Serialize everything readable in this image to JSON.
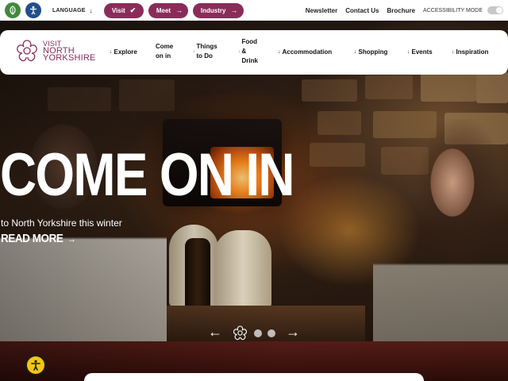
{
  "topbar": {
    "language_label": "LANGUAGE",
    "pills": [
      {
        "label": "Visit",
        "icon": "check-icon"
      },
      {
        "label": "Meet",
        "icon": "arrow-right-icon"
      },
      {
        "label": "Industry",
        "icon": "arrow-right-icon"
      }
    ],
    "links": [
      "Newsletter",
      "Contact Us",
      "Brochure"
    ],
    "accessibility_label": "ACCESSIBILITY MODE",
    "brand_color": "#8a2c59"
  },
  "logo": {
    "line1": "VISIT",
    "line2": "NORTH",
    "line3": "YORKSHIRE"
  },
  "nav": {
    "explore": "Explore",
    "come_on_in_1": "Come",
    "come_on_in_2": "on in",
    "things_1": "Things",
    "things_2": "to Do",
    "food_1": "Food",
    "food_2": "&",
    "food_3": "Drink",
    "accommodation": "Accommodation",
    "shopping": "Shopping",
    "events": "Events",
    "inspiration": "Inspiration"
  },
  "hero": {
    "headline": "COME ON IN",
    "subline": "to North Yorkshire this winter",
    "read_more": "READ MORE"
  },
  "carousel": {
    "prev": "←",
    "next": "→"
  }
}
